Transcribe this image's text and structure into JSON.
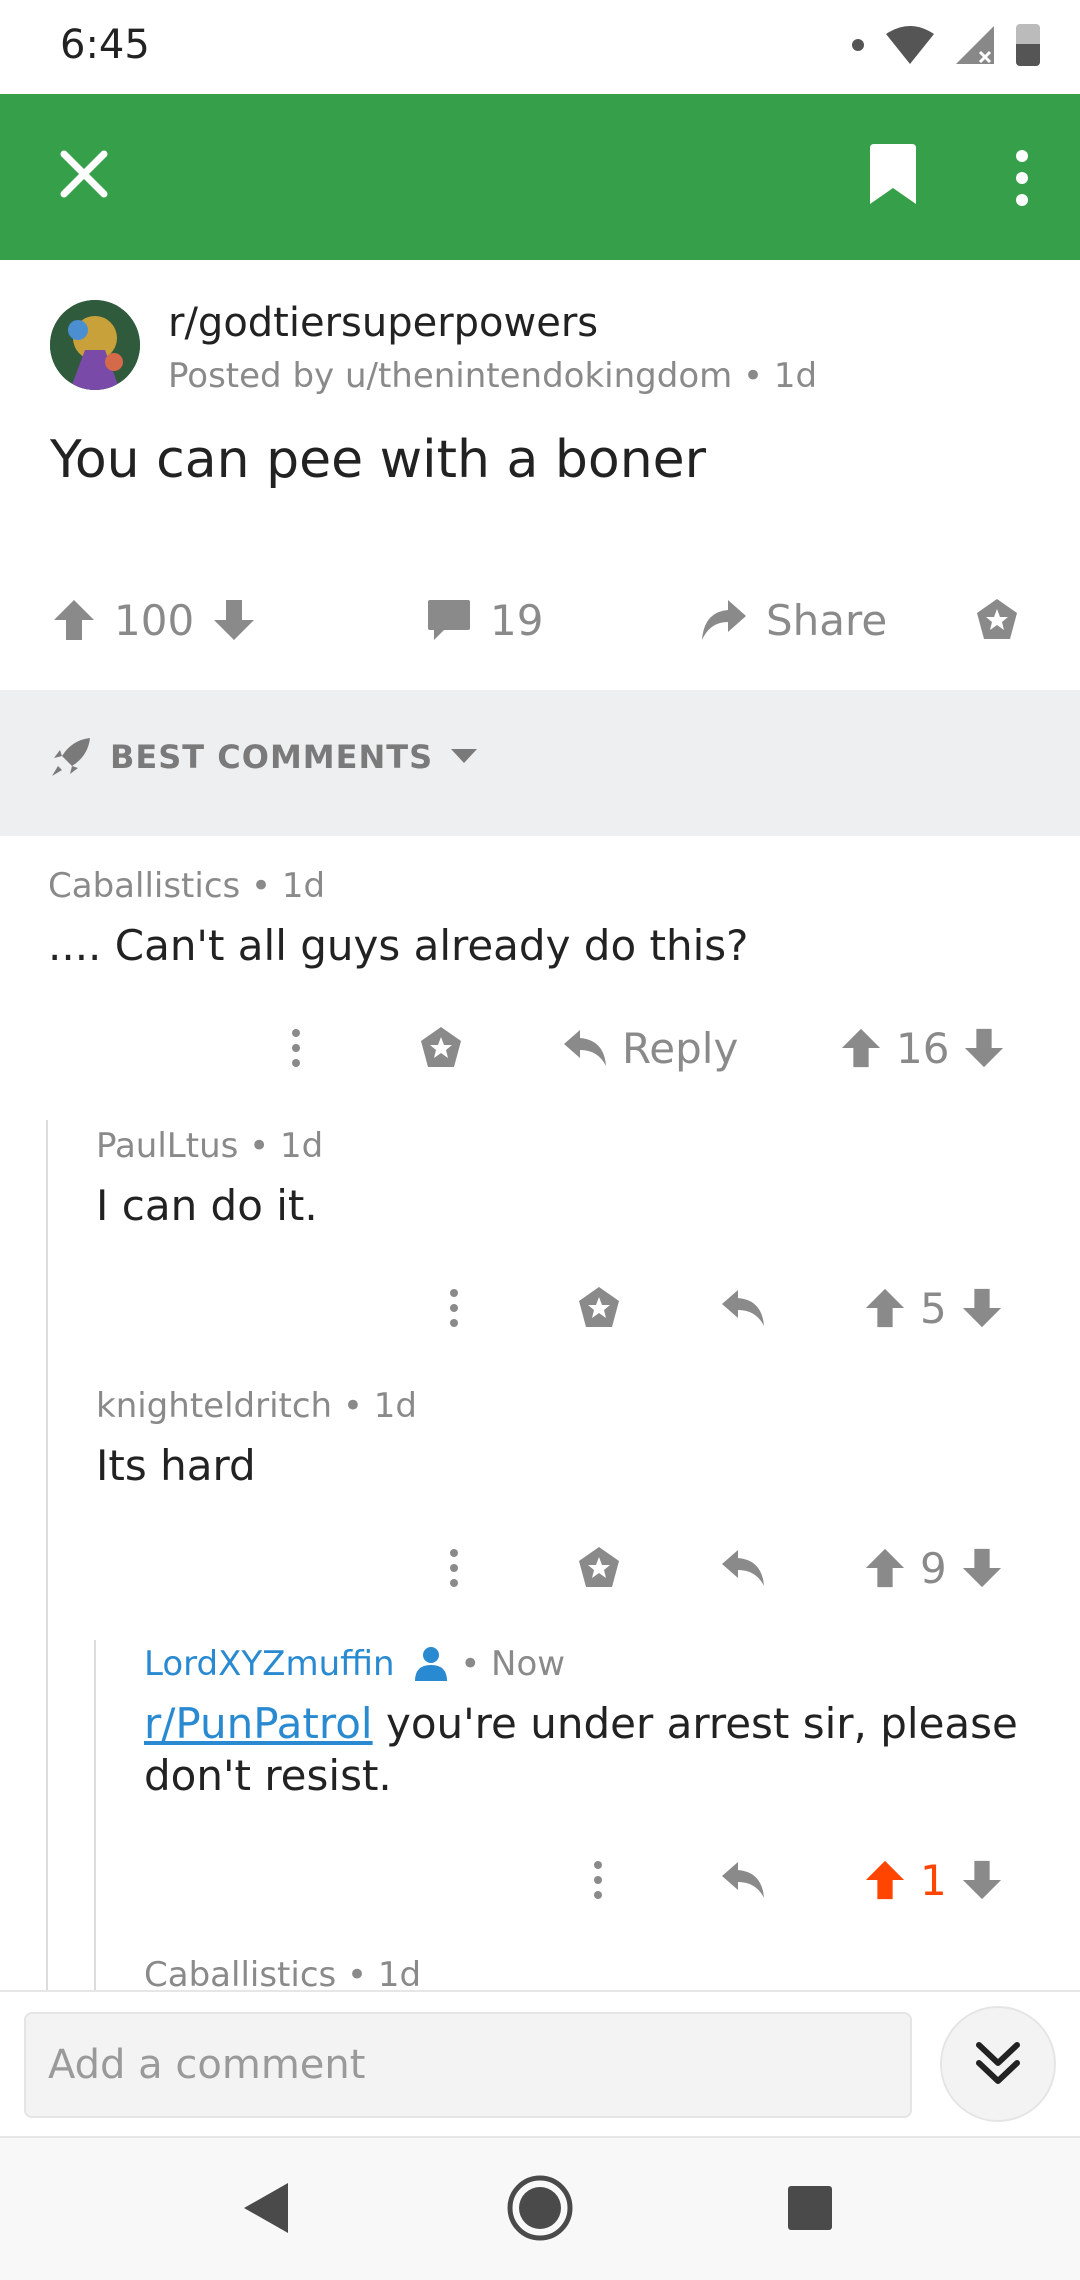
{
  "status_bar": {
    "time": "6:45"
  },
  "post": {
    "subreddit": "r/godtiersuperpowers",
    "posted_by": "Posted by u/thenintendokingdom • 1d",
    "title": "You can pee with a boner",
    "score": "100",
    "comments_count": "19",
    "share_label": "Share"
  },
  "sort": {
    "label": "BEST COMMENTS"
  },
  "comments": [
    {
      "meta": "Caballistics • 1d",
      "body": ".... Can't all guys already do this?",
      "score": "16",
      "reply_label": "Reply"
    },
    {
      "meta": "PaulLtus • 1d",
      "body": "I can do it.",
      "score": "5"
    },
    {
      "meta": "knighteldritch • 1d",
      "body": "Its hard",
      "score": "9"
    },
    {
      "author": "LordXYZmuffin",
      "time": "• Now",
      "link": "r/PunPatrol",
      "body": "you're under arrest sir, please don't resist.",
      "score": "1"
    },
    {
      "meta": "Caballistics • 1d"
    }
  ],
  "comment_input": {
    "placeholder": "Add a comment"
  },
  "colors": {
    "toolbar": "#369f4a",
    "upvoted": "#ff4500",
    "link": "#2a8ad1"
  },
  "icons": [
    "close-icon",
    "bookmark-icon",
    "more-vert-icon",
    "upvote-icon",
    "downvote-icon",
    "comment-icon",
    "share-icon",
    "award-icon",
    "rocket-icon",
    "reply-icon",
    "user-icon",
    "chevrons-down-icon",
    "back-icon",
    "home-icon",
    "recents-icon"
  ]
}
